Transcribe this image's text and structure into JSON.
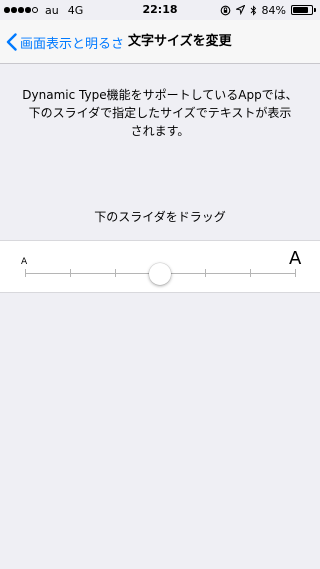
{
  "status_bar": {
    "signal_filled": 4,
    "signal_total": 5,
    "carrier": "au",
    "network": "4G",
    "time": "22:18",
    "battery_text": "84%",
    "battery_level": 0.84
  },
  "nav": {
    "back_label": "画面表示と明るさ",
    "title": "文字サイズを変更"
  },
  "description": "Dynamic Type機能をサポートしているAppでは、\n下のスライダで指定したサイズでテキストが表示\nされます。",
  "slider": {
    "hint": "下のスライダをドラッグ",
    "min_label": "A",
    "max_label": "A",
    "steps": 7,
    "value_index": 3
  },
  "colors": {
    "accent": "#007aff",
    "background": "#efeff4",
    "panel": "#ffffff"
  }
}
